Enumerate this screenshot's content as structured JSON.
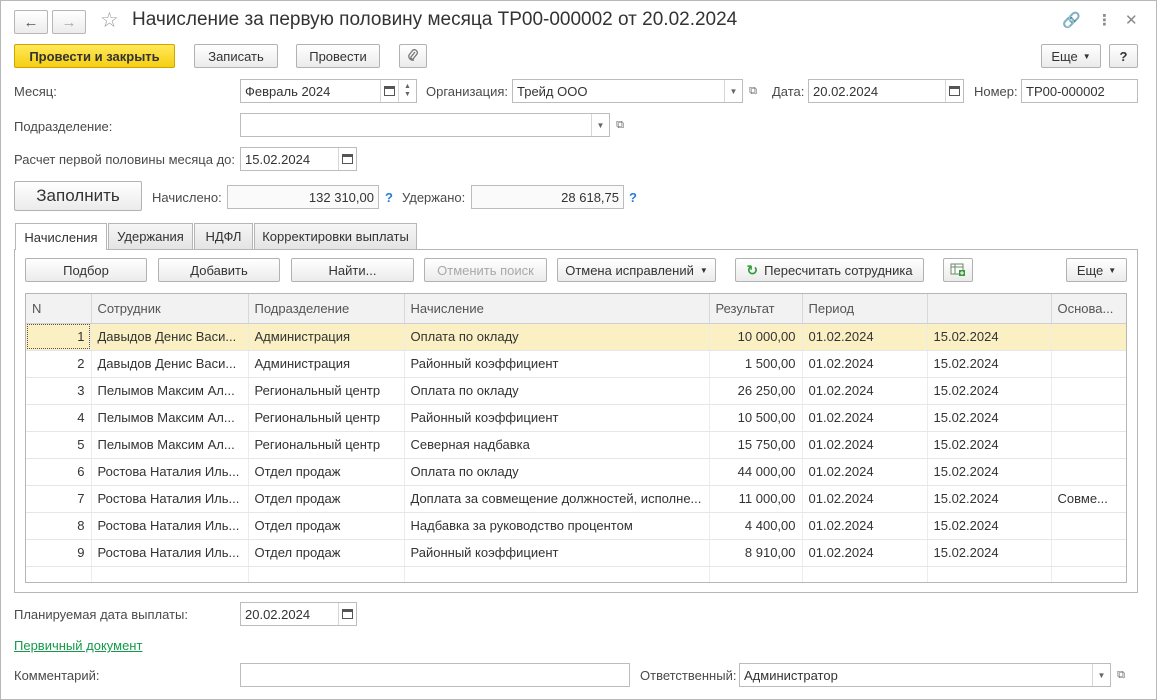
{
  "window": {
    "title": "Начисление за первую половину месяца ТР00-000002 от 20.02.2024",
    "back_icon": "arrow-left-icon",
    "forward_icon": "arrow-right-icon",
    "star_icon": "star-icon",
    "link_icon": "link-icon",
    "menu_icon": "more-vertical-icon",
    "close_icon": "close-icon"
  },
  "toolbar": {
    "post_close": "Провести и закрыть",
    "save": "Записать",
    "post": "Провести",
    "more": "Еще",
    "help": "?"
  },
  "form": {
    "month_label": "Месяц:",
    "month_value": "Февраль 2024",
    "org_label": "Организация:",
    "org_value": "Трейд ООО",
    "date_label": "Дата:",
    "date_value": "20.02.2024",
    "number_label": "Номер:",
    "number_value": "ТР00-000002",
    "division_label": "Подразделение:",
    "division_value": "",
    "calc_until_label": "Расчет первой половины месяца до:",
    "calc_until_value": "15.02.2024",
    "fill_button": "Заполнить",
    "accrued_label": "Начислено:",
    "accrued_value": "132 310,00",
    "withheld_label": "Удержано:",
    "withheld_value": "28 618,75",
    "help_mark": "?"
  },
  "tabs": [
    "Начисления",
    "Удержания",
    "НДФЛ",
    "Корректировки выплаты"
  ],
  "table_toolbar": {
    "select": "Подбор",
    "add": "Добавить",
    "find": "Найти...",
    "cancel_search": "Отменить поиск",
    "cancel_corrections": "Отмена исправлений",
    "recalc": "Пересчитать сотрудника",
    "more": "Еще"
  },
  "table": {
    "columns": [
      "N",
      "Сотрудник",
      "Подразделение",
      "Начисление",
      "Результат",
      "Период",
      "",
      "Основа..."
    ],
    "rows": [
      {
        "n": "1",
        "employee": "Давыдов Денис Васи...",
        "division": "Администрация",
        "accrual": "Оплата по окладу",
        "result": "10 000,00",
        "from": "01.02.2024",
        "to": "15.02.2024",
        "basis": ""
      },
      {
        "n": "2",
        "employee": "Давыдов Денис Васи...",
        "division": "Администрация",
        "accrual": "Районный коэффициент",
        "result": "1 500,00",
        "from": "01.02.2024",
        "to": "15.02.2024",
        "basis": ""
      },
      {
        "n": "3",
        "employee": "Пелымов Максим Ал...",
        "division": "Региональный центр",
        "accrual": "Оплата по окладу",
        "result": "26 250,00",
        "from": "01.02.2024",
        "to": "15.02.2024",
        "basis": ""
      },
      {
        "n": "4",
        "employee": "Пелымов Максим Ал...",
        "division": "Региональный центр",
        "accrual": "Районный коэффициент",
        "result": "10 500,00",
        "from": "01.02.2024",
        "to": "15.02.2024",
        "basis": ""
      },
      {
        "n": "5",
        "employee": "Пелымов Максим Ал...",
        "division": "Региональный центр",
        "accrual": "Северная надбавка",
        "result": "15 750,00",
        "from": "01.02.2024",
        "to": "15.02.2024",
        "basis": ""
      },
      {
        "n": "6",
        "employee": "Ростова Наталия Иль...",
        "division": "Отдел продаж",
        "accrual": "Оплата по окладу",
        "result": "44 000,00",
        "from": "01.02.2024",
        "to": "15.02.2024",
        "basis": ""
      },
      {
        "n": "7",
        "employee": "Ростова Наталия Иль...",
        "division": "Отдел продаж",
        "accrual": "Доплата за совмещение должностей, исполне...",
        "result": "11 000,00",
        "from": "01.02.2024",
        "to": "15.02.2024",
        "basis": "Совме..."
      },
      {
        "n": "8",
        "employee": "Ростова Наталия Иль...",
        "division": "Отдел продаж",
        "accrual": "Надбавка за руководство процентом",
        "result": "4 400,00",
        "from": "01.02.2024",
        "to": "15.02.2024",
        "basis": ""
      },
      {
        "n": "9",
        "employee": "Ростова Наталия Иль...",
        "division": "Отдел продаж",
        "accrual": "Районный коэффициент",
        "result": "8 910,00",
        "from": "01.02.2024",
        "to": "15.02.2024",
        "basis": ""
      }
    ]
  },
  "footer": {
    "pay_date_label": "Планируемая дата выплаты:",
    "pay_date_value": "20.02.2024",
    "primary_doc_link": "Первичный документ",
    "comment_label": "Комментарий:",
    "comment_value": "",
    "responsible_label": "Ответственный:",
    "responsible_value": "Администратор"
  }
}
